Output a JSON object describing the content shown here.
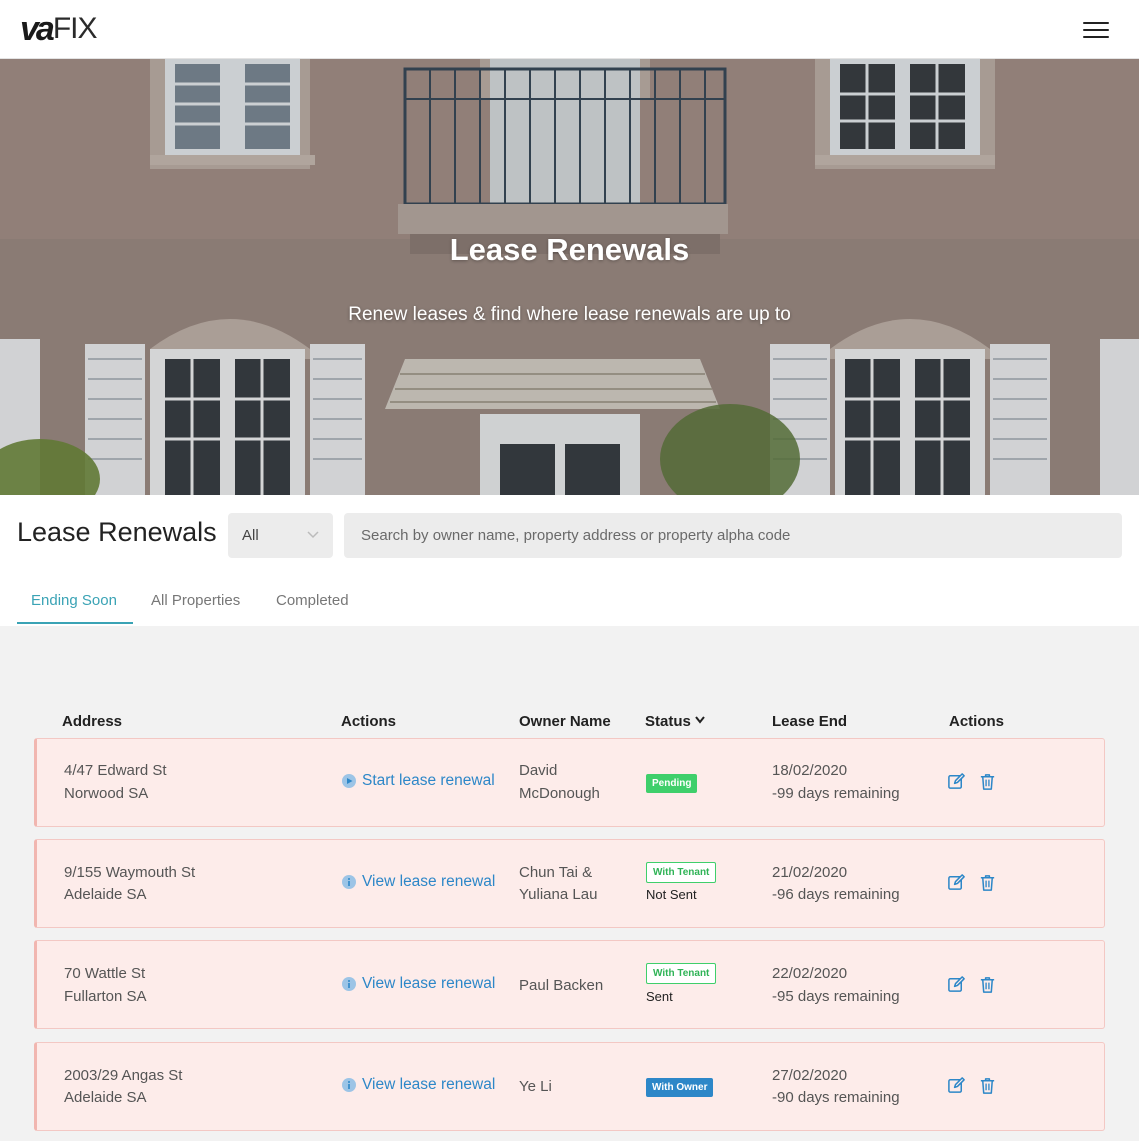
{
  "header": {
    "logo_va": "va",
    "logo_fix": "FIX"
  },
  "hero": {
    "title": "Lease Renewals",
    "subtitle": "Renew leases & find where lease renewals are up to"
  },
  "toolbar": {
    "title": "Lease Renewals",
    "filter_value": "All",
    "search_placeholder": "Search by owner name, property address or property alpha code"
  },
  "tabs": [
    {
      "label": "Ending Soon",
      "active": true
    },
    {
      "label": "All Properties",
      "active": false
    },
    {
      "label": "Completed",
      "active": false
    }
  ],
  "table": {
    "headers": {
      "address": "Address",
      "actions": "Actions",
      "owner": "Owner Name",
      "status": "Status",
      "lease_end": "Lease End",
      "actions2": "Actions"
    },
    "rows": [
      {
        "address_line1": "4/47 Edward St",
        "address_line2": "Norwood SA",
        "action": "Start lease renewal",
        "action_icon": "play-circle-icon",
        "owner_line1": "David",
        "owner_line2": "McDonough",
        "status": "Pending",
        "substatus": "",
        "lease_end_date": "18/02/2020",
        "days_remaining": "-99 days remaining"
      },
      {
        "address_line1": "9/155 Waymouth St",
        "address_line2": "Adelaide SA",
        "action": "View lease renewal",
        "action_icon": "info-circle-icon",
        "owner_line1": "Chun Tai &",
        "owner_line2": "Yuliana Lau",
        "status": "With Tenant",
        "substatus": "Not Sent",
        "lease_end_date": "21/02/2020",
        "days_remaining": "-96 days remaining"
      },
      {
        "address_line1": "70 Wattle St",
        "address_line2": "Fullarton SA",
        "action": "View lease renewal",
        "action_icon": "info-circle-icon",
        "owner_line1": "Paul Backen",
        "owner_line2": "",
        "status": "With Tenant",
        "substatus": "Sent",
        "lease_end_date": "22/02/2020",
        "days_remaining": "-95 days remaining"
      },
      {
        "address_line1": "2003/29 Angas St",
        "address_line2": "Adelaide SA",
        "action": "View lease renewal",
        "action_icon": "info-circle-icon",
        "owner_line1": "Ye Li",
        "owner_line2": "",
        "status": "With Owner",
        "substatus": "",
        "lease_end_date": "27/02/2020",
        "days_remaining": "-90 days remaining"
      }
    ]
  },
  "colors": {
    "accent": "#3aa3b5",
    "link": "#2d87c8",
    "pending": "#3fcf6b",
    "row_bg": "#fdecea",
    "row_border": "#f3c8c4"
  }
}
